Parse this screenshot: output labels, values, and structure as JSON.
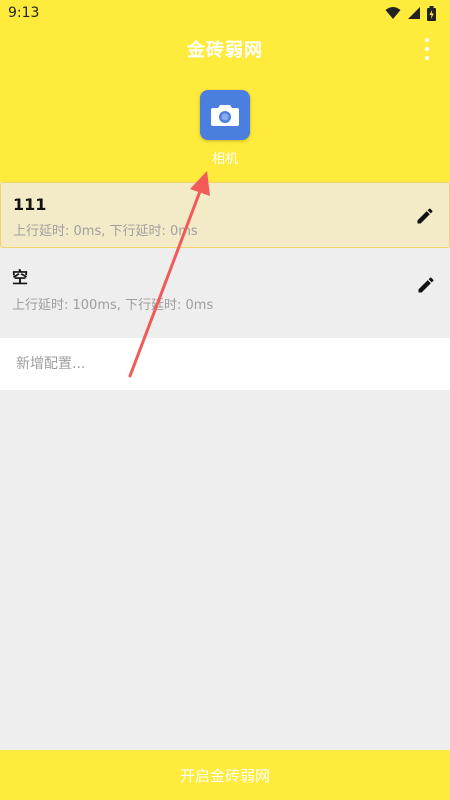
{
  "status_bar": {
    "time": "9:13"
  },
  "app_bar": {
    "title": "金砖弱网"
  },
  "header": {
    "app_name": "相机"
  },
  "configs": [
    {
      "name": "111",
      "detail": "上行延时: 0ms, 下行延时: 0ms"
    },
    {
      "name": "空",
      "detail": "上行延时: 100ms, 下行延时: 0ms"
    }
  ],
  "add_config": {
    "placeholder": "新增配置..."
  },
  "bottom_button": {
    "label": "开启金砖弱网"
  },
  "colors": {
    "accent": "#ffeb3b",
    "arrow": "#f25a5a",
    "icon_bg": "#4a7fe0"
  }
}
